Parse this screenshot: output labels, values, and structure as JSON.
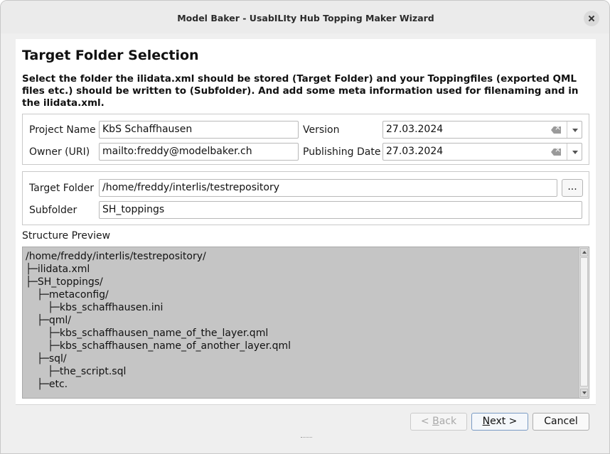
{
  "window": {
    "title": "Model Baker - UsabILIty Hub Topping Maker Wizard"
  },
  "page": {
    "heading": "Target Folder Selection",
    "description": "Select the folder the ilidata.xml should be stored (Target Folder) and your Toppingfiles (exported QML files etc.) should be written to (Subfolder). And add some meta information used for filenaming and in the ilidata.xml."
  },
  "meta": {
    "project_name_label": "Project Name",
    "project_name_value": "KbS Schaffhausen",
    "owner_label": "Owner (URI)",
    "owner_value": "mailto:freddy@modelbaker.ch",
    "version_label": "Version",
    "version_value": "27.03.2024",
    "publishing_date_label": "Publishing Date",
    "publishing_date_value": "27.03.2024"
  },
  "folders": {
    "target_label": "Target Folder",
    "target_value": "/home/freddy/interlis/testrepository",
    "browse_label": "...",
    "subfolder_label": "Subfolder",
    "subfolder_value": "SH_toppings"
  },
  "preview": {
    "label": "Structure Preview",
    "lines": [
      "/home/freddy/interlis/testrepository/",
      "├─ilidata.xml",
      "├─SH_toppings/",
      "├─metaconfig/",
      "├─kbs_schaffhausen.ini",
      "├─qml/",
      "├─kbs_schaffhausen_name_of_the_layer.qml",
      "├─kbs_schaffhausen_name_of_another_layer.qml",
      "├─sql/",
      "├─the_script.sql",
      "├─etc."
    ]
  },
  "buttons": {
    "back_prefix": "< ",
    "back_mnemonic": "B",
    "back_rest": "ack",
    "next_mnemonic": "N",
    "next_rest": "ext >",
    "cancel": "Cancel"
  },
  "colors": {
    "preview_background": "#c5c5c5",
    "window_background": "#efefef"
  }
}
